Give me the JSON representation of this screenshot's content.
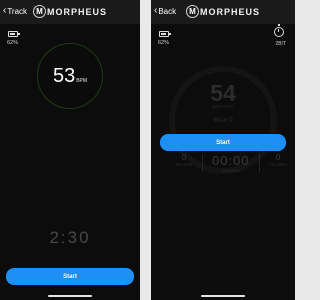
{
  "left_screen": {
    "back_label": "Track",
    "logo_text": "MORPHEUS",
    "logo_mark": "M",
    "battery_pct": "62%",
    "battery_fill": 0.62,
    "heart_rate": "53",
    "heart_rate_unit": "BPM",
    "timer": "2:30",
    "start_label": "Start"
  },
  "right_screen": {
    "back_label": "Back",
    "logo_text": "MORPHEUS",
    "logo_mark": "M",
    "battery_pct": "62%",
    "battery_fill": 0.62,
    "timer_label": "2BIT",
    "rep_value": "54",
    "rep_unit": "BREATHS",
    "max_label": "MAX 0",
    "start_label": "Start",
    "stats": [
      {
        "value": "0",
        "label": "BREATHS"
      },
      {
        "value": "00:00",
        "label": "DURATION"
      },
      {
        "value": "0",
        "label": "CALORIES"
      }
    ]
  },
  "colors": {
    "accent": "#1d8ff5",
    "ring": "#223a14",
    "background": "#0c0c0c"
  },
  "icons": [
    "back-chevron-icon",
    "morpheus-logo-icon",
    "battery-icon",
    "stopwatch-icon"
  ]
}
